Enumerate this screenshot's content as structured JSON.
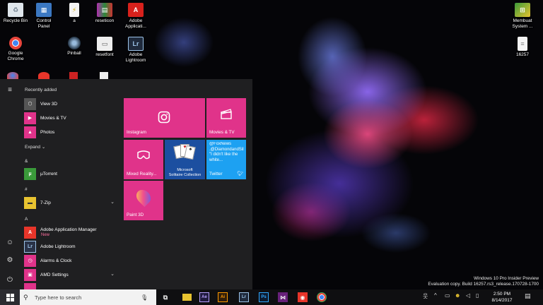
{
  "desktop": {
    "icons": [
      {
        "label": "Recycle Bin",
        "icon": "recycle-bin-icon"
      },
      {
        "label": "Control\nPanel",
        "icon": "control-panel-icon"
      },
      {
        "label": "a",
        "icon": "file-icon"
      },
      {
        "label": "reseticon",
        "icon": "archive-icon"
      },
      {
        "label": "Adobe\nApplicati...",
        "icon": "adobe-icon"
      },
      {
        "label": "Google\nChrome",
        "icon": "chrome-icon"
      },
      {
        "label": "Pinball",
        "icon": "pinball-icon"
      },
      {
        "label": "resetfont",
        "icon": "file-icon"
      },
      {
        "label": "Adobe\nLightroom",
        "icon": "lightroom-icon"
      },
      {
        "label": "Membuat\nSystem ...",
        "icon": "installer-icon"
      },
      {
        "label": "16257",
        "icon": "document-icon"
      }
    ]
  },
  "start_menu": {
    "recently_added_header": "Recently added",
    "recent_apps": [
      "View 3D",
      "Movies & TV",
      "Photos"
    ],
    "expand_label": "Expand",
    "sections": [
      {
        "letter": "&",
        "apps": [
          {
            "name": "µTorrent",
            "color": "#3a9a3a"
          }
        ]
      },
      {
        "letter": "#",
        "apps": [
          {
            "name": "7-Zip",
            "color": "#e8c330",
            "expandable": true
          }
        ]
      },
      {
        "letter": "A",
        "apps": [
          {
            "name": "Adobe Application Manager",
            "badge": "New",
            "color": "#e8352a"
          },
          {
            "name": "Adobe Lightroom",
            "color": "#2a3348"
          },
          {
            "name": "Alarms & Clock",
            "color": "#e0338a"
          },
          {
            "name": "AMD Settings",
            "color": "#e0338a",
            "expandable": true
          }
        ]
      }
    ],
    "tiles": {
      "instagram": "Instagram",
      "movies_tv": "Movies & TV",
      "mixed_reality": "Mixed Reality...",
      "solitaire": "Microsoft\nSolitaire Collection",
      "twitter_text": "@FoxNews\n.@DiamondandSilk: \"I didn't like the white...",
      "twitter": "Twitter",
      "paint3d": "Paint 3D"
    },
    "tile_color": "#e0338a",
    "twitter_color": "#1da1f2"
  },
  "taskbar": {
    "search_placeholder": "Type here to search",
    "time": "2:50 PM",
    "date": "8/14/2017"
  },
  "watermark": {
    "line1": "Windows 10 Pro Insider Preview",
    "line2": "Evaluation copy. Build 16257.rs3_release.170728-1700"
  }
}
